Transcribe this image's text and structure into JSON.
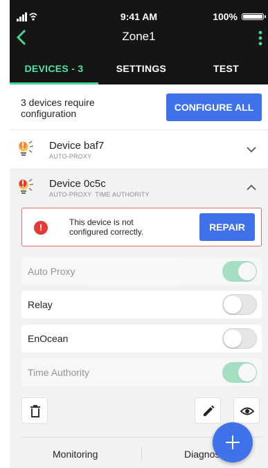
{
  "status_bar": {
    "time": "9:41 AM",
    "battery": "100%"
  },
  "nav": {
    "title": "Zone1"
  },
  "tabs": [
    {
      "label": "DEVICES - 3"
    },
    {
      "label": "SETTINGS"
    },
    {
      "label": "TEST"
    }
  ],
  "config_banner": {
    "message": "3 devices require configuration",
    "button_label": "CONFIGURE ALL"
  },
  "devices": [
    {
      "name": "Device baf7",
      "tags": "AUTO-PROXY"
    },
    {
      "name": "Device 0c5c",
      "tags": "AUTO-PROXY  TIME AUTHORITY"
    }
  ],
  "alert": {
    "message": "This device is not configured correctly.",
    "button_label": "REPAIR"
  },
  "settings": [
    {
      "label": "Auto Proxy",
      "on": true,
      "disabled": true
    },
    {
      "label": "Relay",
      "on": false,
      "disabled": false
    },
    {
      "label": "EnOcean",
      "on": false,
      "disabled": false
    },
    {
      "label": "Time Authority",
      "on": true,
      "disabled": true
    }
  ],
  "bottom_tabs": [
    {
      "label": "Monitoring"
    },
    {
      "label": "Diagnostics"
    }
  ],
  "icons": {
    "back": "chevron-left-icon",
    "more": "more-vertical-icon",
    "bulb_warning": "lightbulb-warning-icon",
    "alert": "error-icon",
    "delete": "trash-icon",
    "edit": "pencil-icon",
    "view": "eye-icon",
    "add": "plus-icon"
  },
  "colors": {
    "header_bg": "#151515",
    "accent_green": "#47d68f",
    "primary_blue": "#3f71ea",
    "error_red": "#e53935",
    "toggle_on": "#47c98a"
  }
}
